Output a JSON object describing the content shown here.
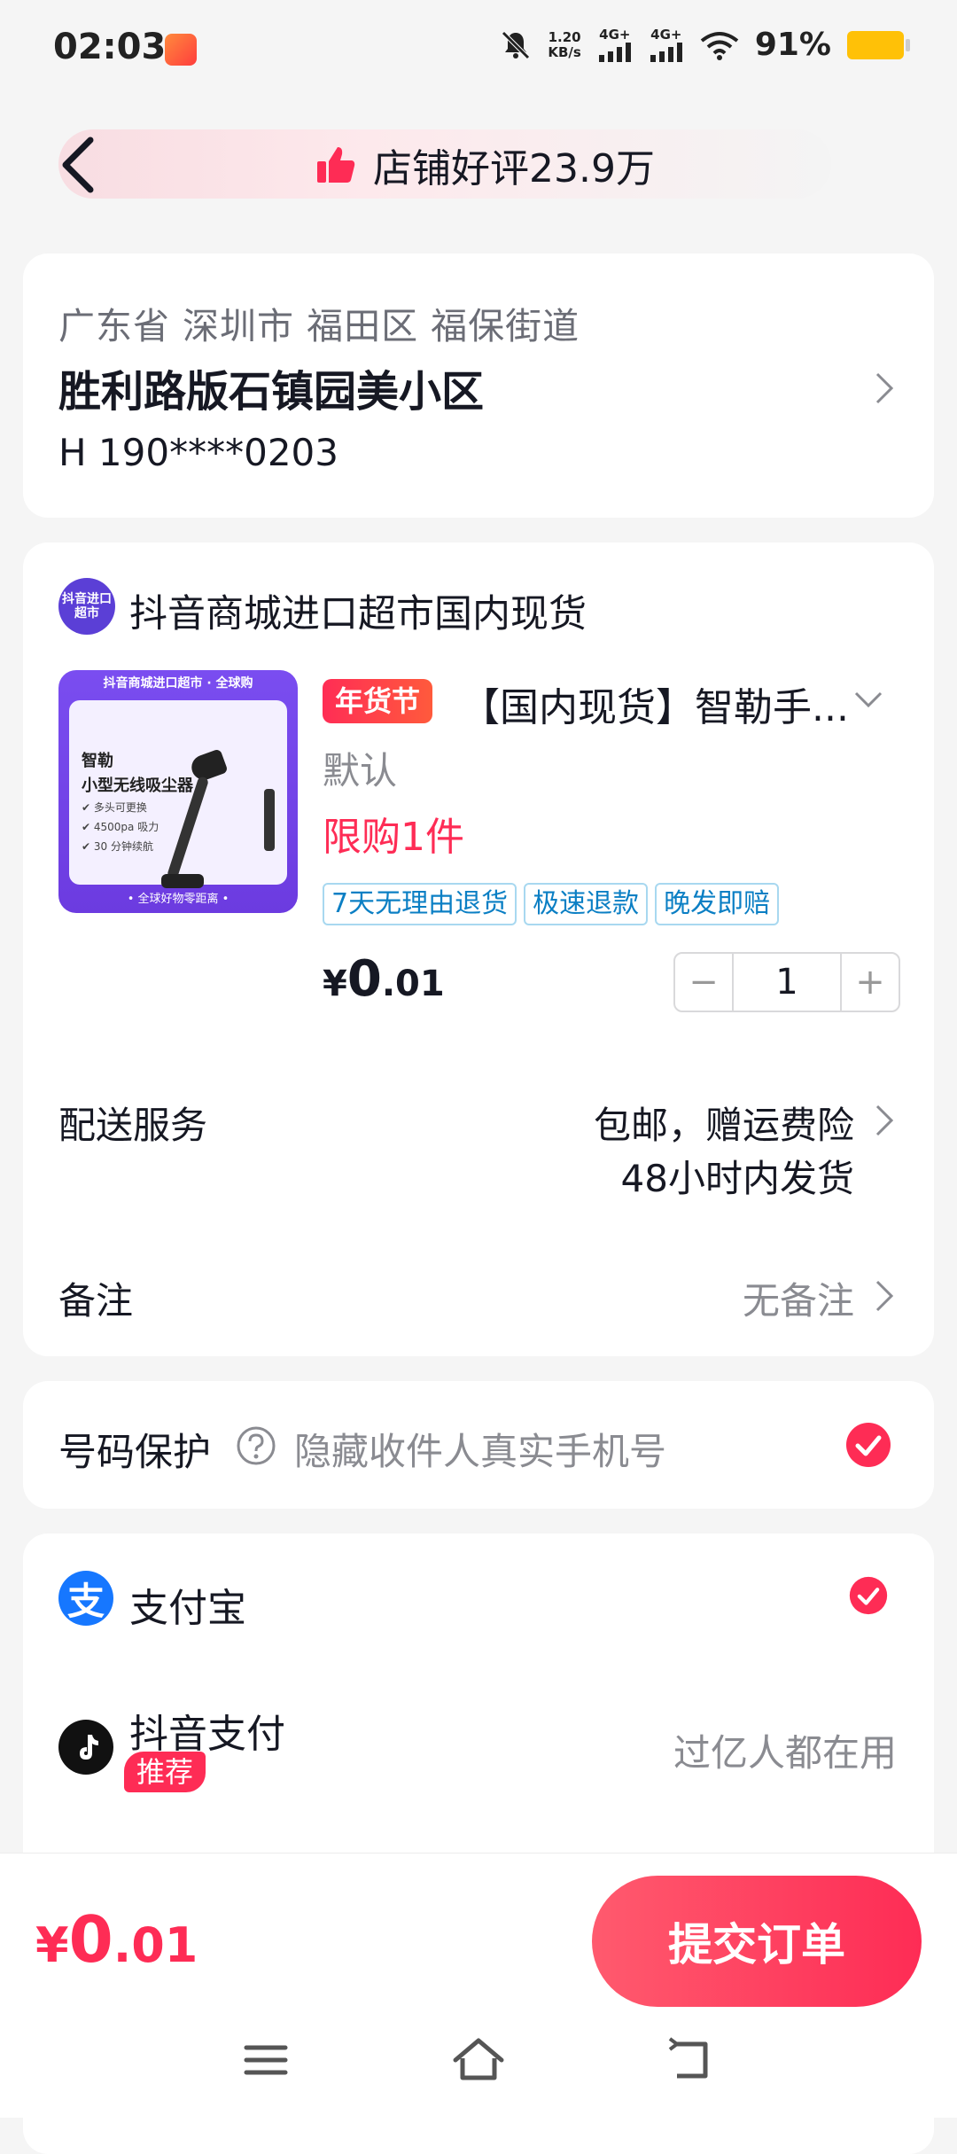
{
  "status_bar": {
    "time": "02:03",
    "net_speed_value": "1.20",
    "net_speed_unit": "KB/s",
    "signal1": "4G+",
    "signal2": "4G+",
    "battery": "91%"
  },
  "header": {
    "praise_text": "店铺好评23.9万"
  },
  "address": {
    "region": "广东省 深圳市 福田区 福保街道",
    "detail": "胜利路版石镇园美小区",
    "contact": "H 190****0203"
  },
  "shop": {
    "logo_text": "抖音进口超市",
    "name": "抖音商城进口超市国内现货"
  },
  "product": {
    "image_top_text": "抖音商城进口超市 · 全球购",
    "image_line1": "智勒",
    "image_line2": "小型无线吸尘器",
    "image_feature1": "✔ 多头可更换",
    "image_feature2": "✔ 4500pa 吸力",
    "image_feature3": "✔ 30 分钟续航",
    "image_bottom_text": "• 全球好物零距离 •",
    "festival_tag": "年货节",
    "title": "【国内现货】智勒手...",
    "spec": "默认",
    "limit": "限购1件",
    "service_tags": [
      "7天无理由退货",
      "极速退款",
      "晚发即赔"
    ],
    "price_currency": "¥",
    "price_int": "0",
    "price_dec": ".01",
    "quantity": "1",
    "minus": "−",
    "plus": "+"
  },
  "delivery": {
    "label": "配送服务",
    "value1": "包邮，赠运费险",
    "value2": "48小时内发货"
  },
  "note": {
    "label": "备注",
    "value": "无备注"
  },
  "phone_protect": {
    "label": "号码保护",
    "desc": "隐藏收件人真实手机号",
    "checked": true
  },
  "payment": {
    "alipay_icon_text": "支",
    "alipay_label": "支付宝",
    "alipay_selected": true,
    "douyin_label": "抖音支付",
    "douyin_badge": "推荐",
    "douyin_desc": "过亿人都在用"
  },
  "bottom": {
    "total_currency": "¥",
    "total_int": "0",
    "total_dec": ".01",
    "submit_label": "提交订单"
  },
  "colors": {
    "accent": "#fe2c55",
    "link_blue": "#0b7fc4",
    "alipay_blue": "#1677ff"
  }
}
